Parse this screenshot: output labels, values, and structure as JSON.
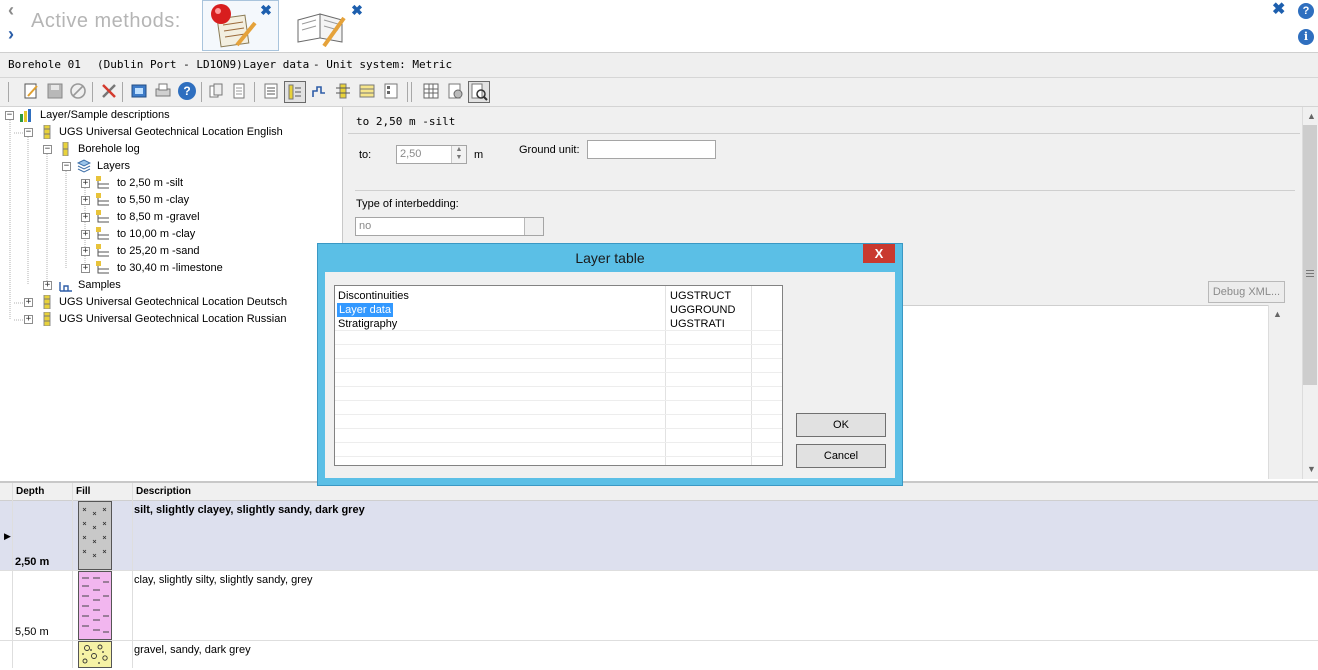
{
  "header": {
    "active_methods_label": "Active methods:",
    "nav_back_glyph": "‹",
    "nav_forward_glyph": "›",
    "close_glyph": "✖",
    "help_glyph": "?",
    "info_glyph": "i"
  },
  "infobar": {
    "borehole": "Borehole 01",
    "project": "(Dublin Port - LD1ON9)",
    "section": "Layer data",
    "unit_system": "-  Unit system: Metric"
  },
  "tree": {
    "root": "Layer/Sample descriptions",
    "location_en": "UGS Universal Geotechnical Location English",
    "borehole_log": "Borehole log",
    "layers": "Layers",
    "layer_items": [
      "to 2,50 m -silt",
      "to 5,50 m -clay",
      "to 8,50 m -gravel",
      "to 10,00 m -clay",
      "to 25,20 m -sand",
      "to 30,40 m -limestone"
    ],
    "samples": "Samples",
    "location_de": "UGS Universal Geotechnical Location Deutsch",
    "location_ru": "UGS Universal Geotechnical Location Russian"
  },
  "detail": {
    "heading": "to 2,50 m -silt",
    "to_label": "to:",
    "to_value": "2,50",
    "to_unit": "m",
    "ground_unit_label": "Ground unit:",
    "ground_unit_value": "",
    "interbedding_label": "Type of interbedding:",
    "interbedding_value": "no",
    "debug_button": "Debug XML..."
  },
  "grid": {
    "columns": [
      "Depth",
      "Fill",
      "Description"
    ],
    "rows": [
      {
        "depth": "2,50 m",
        "description": "silt, slightly clayey, slightly sandy, dark grey",
        "fill_color": "#c8c8c8",
        "selected": true
      },
      {
        "depth": "5,50 m",
        "description": "clay, slightly silty, slightly sandy, grey",
        "fill_color": "#f2b6ef",
        "selected": false
      },
      {
        "depth": "",
        "description": "gravel, sandy, dark grey",
        "fill_color": "#f6f2a6",
        "selected": false
      }
    ]
  },
  "dialog": {
    "title": "Layer table",
    "close_glyph": "X",
    "rows": [
      {
        "name": "Discontinuities",
        "code": "UGSTRUCT"
      },
      {
        "name": "Layer data",
        "code": "UGGROUND"
      },
      {
        "name": "Stratigraphy",
        "code": "UGSTRATI"
      }
    ],
    "ok_label": "OK",
    "cancel_label": "Cancel"
  },
  "colors": {
    "dialog_frame": "#5bbfe6",
    "selection": "#3399ff",
    "selected_row": "#dde0ee"
  }
}
